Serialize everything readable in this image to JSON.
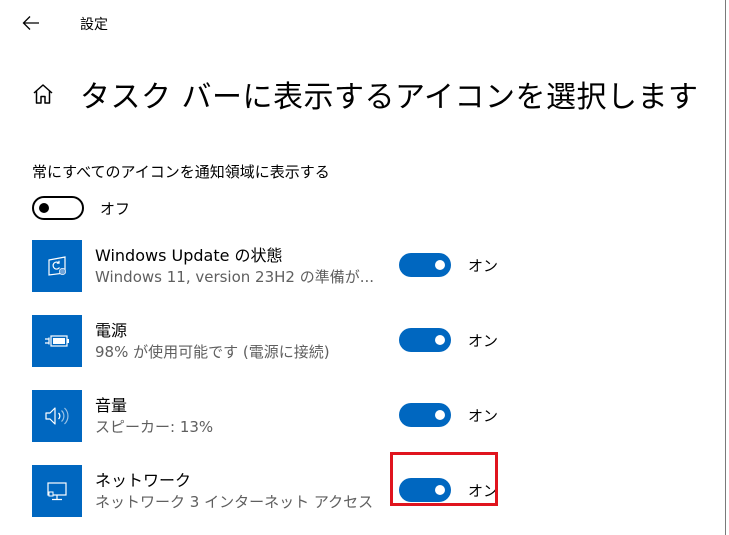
{
  "window": {
    "title": "設定"
  },
  "header": {
    "title": "タスク バーに表示するアイコンを選択します"
  },
  "always_show": {
    "label": "常にすべてのアイコンを通知領域に表示する",
    "state": "off",
    "state_label": "オフ"
  },
  "apps": [
    {
      "name": "Windows Update の状態",
      "subtitle": "Windows 11, version 23H2 の準備が...",
      "icon": "windows-update-icon",
      "state": "on",
      "state_label": "オン"
    },
    {
      "name": "電源",
      "subtitle": "98% が使用可能です (電源に接続)",
      "icon": "battery-charging-icon",
      "state": "on",
      "state_label": "オン"
    },
    {
      "name": "音量",
      "subtitle": "スピーカー: 13%",
      "icon": "speaker-volume-icon",
      "state": "on",
      "state_label": "オン"
    },
    {
      "name": "ネットワーク",
      "subtitle": "ネットワーク 3 インターネット アクセス",
      "icon": "network-monitor-icon",
      "state": "on",
      "state_label": "オン"
    }
  ],
  "colors": {
    "accent": "#0067c0",
    "highlight": "#e0141e",
    "secondary_text": "#5f5f5f"
  }
}
